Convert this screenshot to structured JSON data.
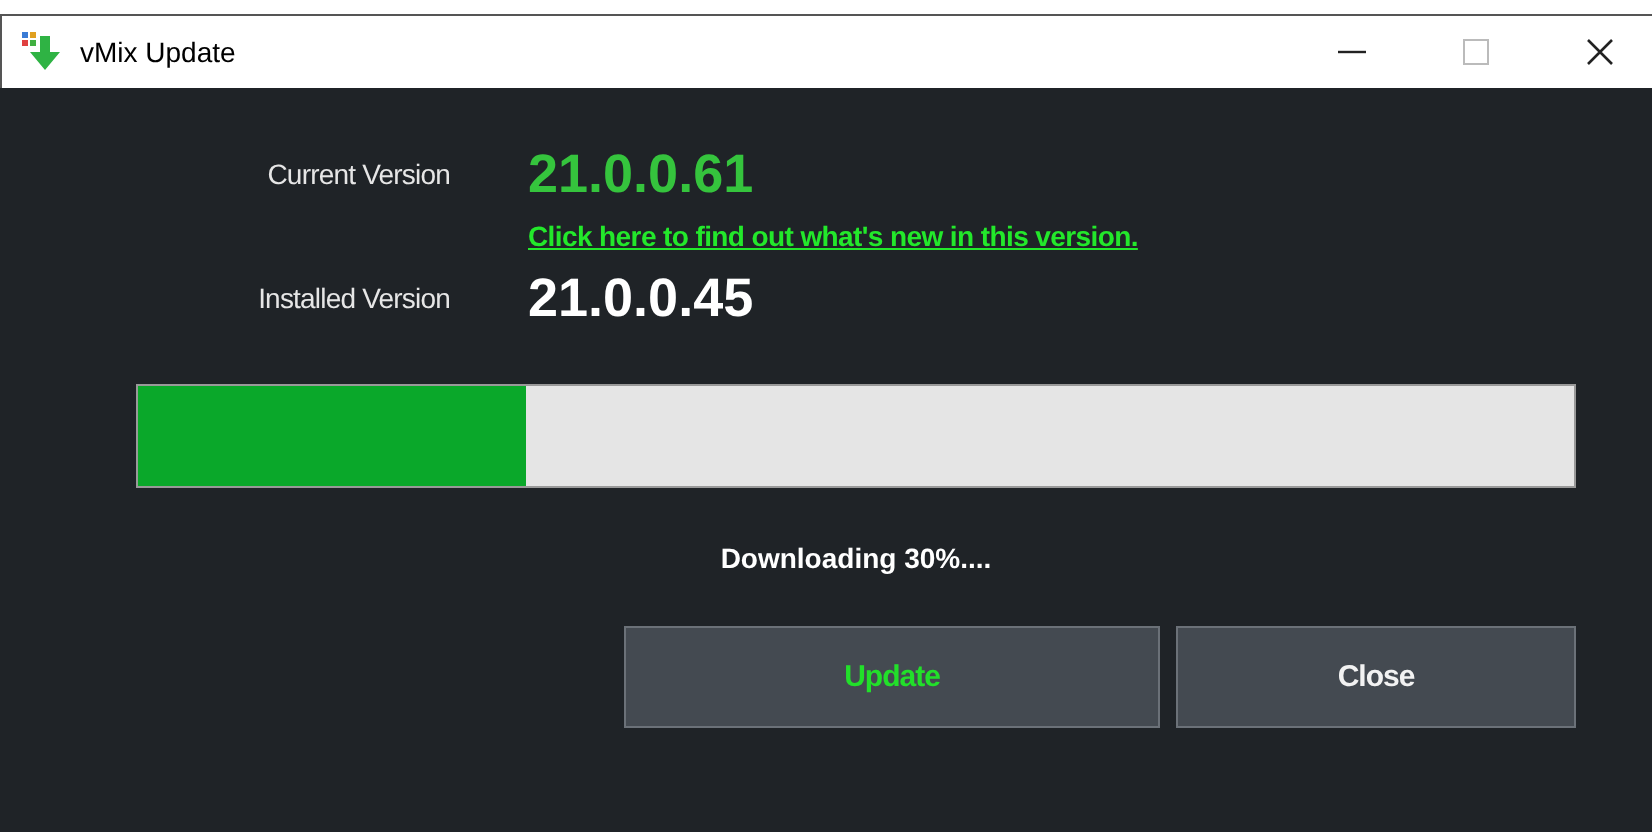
{
  "window": {
    "title": "vMix Update"
  },
  "versions": [
    {
      "label": "Current Version",
      "value": "21.0.0.61",
      "kind": "current"
    },
    {
      "kind": "link",
      "text": "Click here to find out what's new in this version."
    },
    {
      "label": "Installed Version",
      "value": "21.0.0.45",
      "kind": "installed"
    }
  ],
  "progress": {
    "level": 0.27
  },
  "status": "Downloading 30%....",
  "buttons": [
    {
      "label": "Update",
      "kind": "primary"
    },
    {
      "label": "Close",
      "kind": "default"
    }
  ]
}
